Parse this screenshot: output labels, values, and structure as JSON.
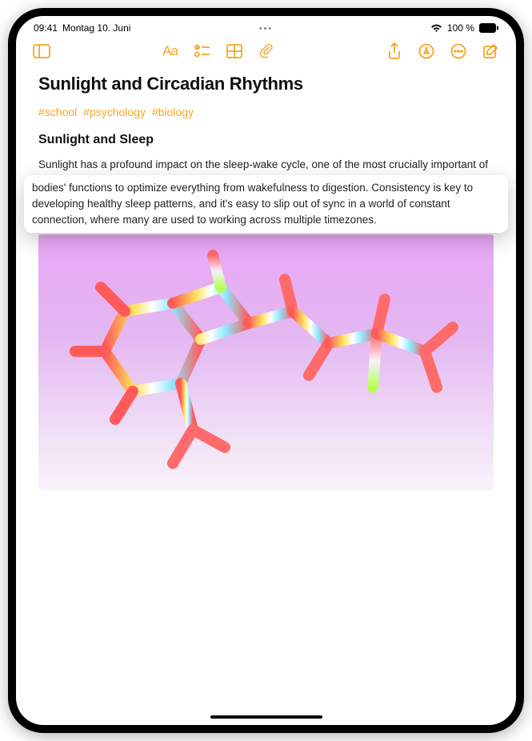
{
  "status": {
    "time": "09:41",
    "date": "Montag 10. Juni",
    "battery_text": "100 %"
  },
  "toolbar": {
    "aa_label": "Aa"
  },
  "note": {
    "title": "Sunlight and Circadian Rhythms",
    "tags": [
      "#school",
      "#psychology",
      "#biology"
    ],
    "subheading": "Sunlight and Sleep",
    "body_part1": "Sunlight has a profound impact on the sleep-wake cycle, one of the most crucially important of our circadian rhythms–a series of cyclical processes that help time our",
    "body_highlight": "bodies' functions to optimize everything from wakefulness to digestion. Consistency is key to developing healthy sleep patterns, and it's easy to slip out of sync in a world of constant connection, where many are used to working across multiple timezones."
  }
}
